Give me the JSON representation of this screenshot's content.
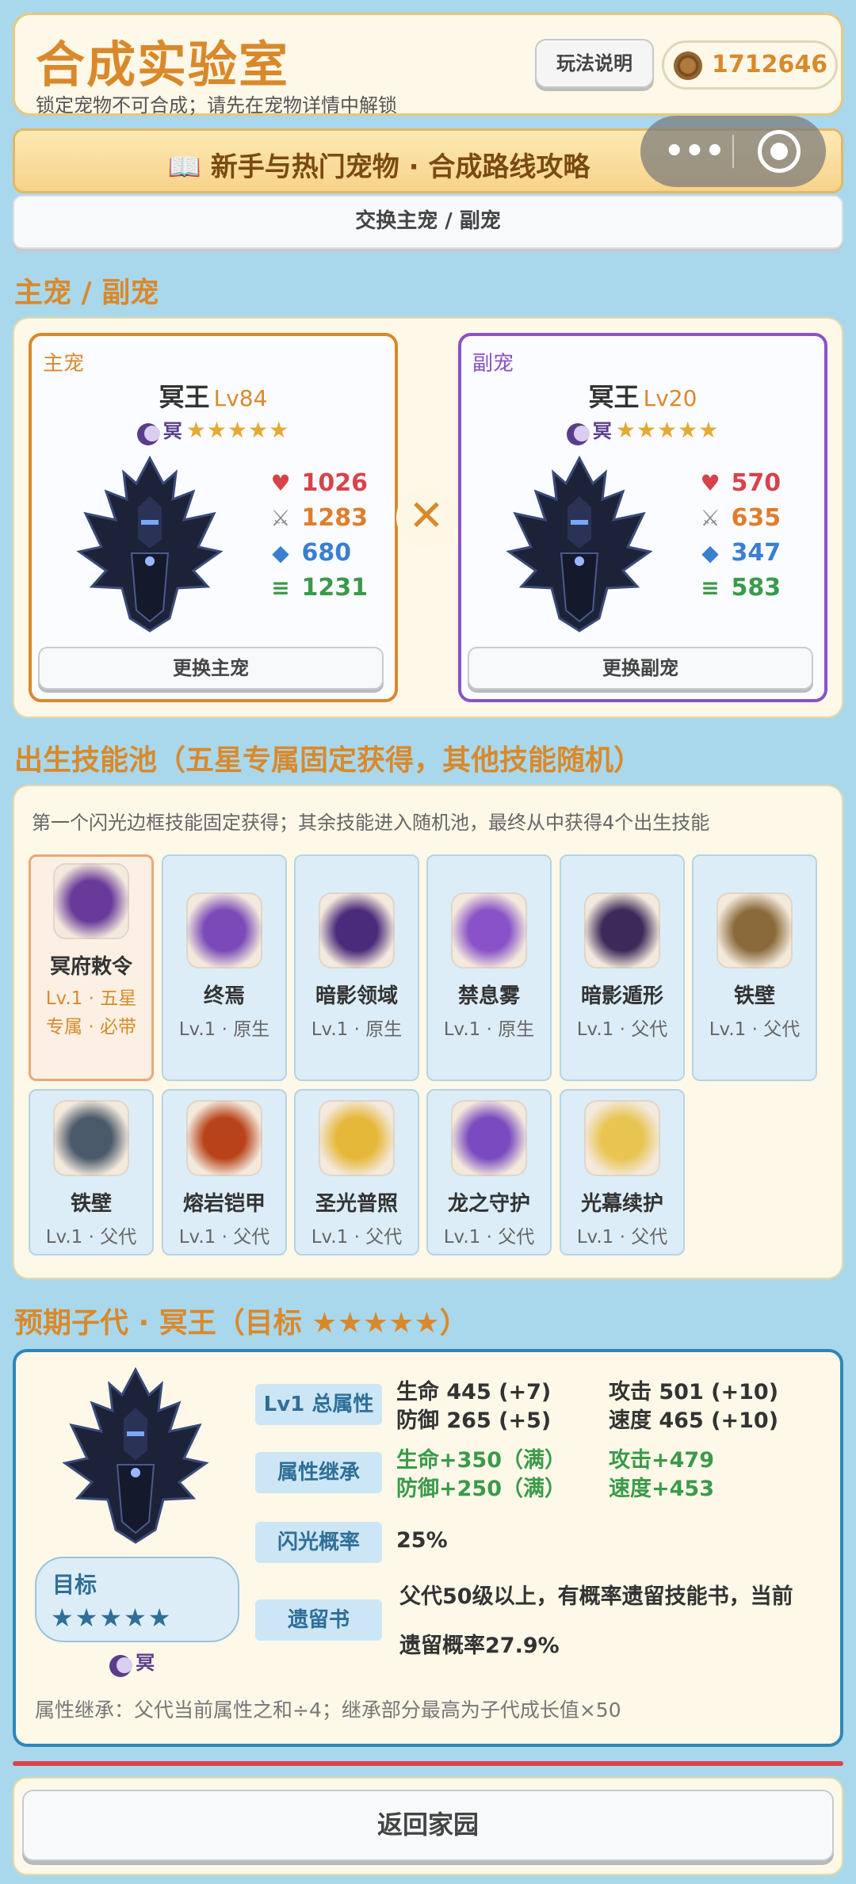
{
  "header": {
    "title": "合成实验室",
    "subtitle": "锁定宠物不可合成；请先在宠物详情中解锁",
    "help_label": "玩法说明",
    "coins": "1712646"
  },
  "guide": {
    "text": "📖 新手与热门宠物 · 合成路线攻略"
  },
  "swap": {
    "label": "交换主宠 / 副宠"
  },
  "pets_section": {
    "title": "主宠 / 副宠"
  },
  "main_pet": {
    "role": "主宠",
    "name": "冥王",
    "level": "Lv84",
    "element": "冥",
    "stars": "★★★★★",
    "hp": "1026",
    "atk": "1283",
    "def": "680",
    "spd": "1231",
    "button": "更换主宠"
  },
  "sub_pet": {
    "role": "副宠",
    "name": "冥王",
    "level": "Lv20",
    "element": "冥",
    "stars": "★★★★★",
    "hp": "570",
    "atk": "635",
    "def": "347",
    "spd": "583",
    "button": "更换副宠"
  },
  "times_symbol": "✕",
  "skills_section": {
    "title": "出生技能池（五星专属固定获得，其他技能随机）",
    "note": "第一个闪光边框技能固定获得；其余技能进入随机池，最终从中获得4个出生技能",
    "skills": [
      {
        "name": "冥府敕令",
        "meta": "Lv.1 · 五星专属 · 必带",
        "icon": "dark-crest-icon",
        "color": "#6a3a9a"
      },
      {
        "name": "终焉",
        "meta": "Lv.1 · 原生",
        "icon": "void-orb-icon",
        "color": "#7b4ab8"
      },
      {
        "name": "暗影领域",
        "meta": "Lv.1 · 原生",
        "icon": "shadow-spikes-icon",
        "color": "#4a2a7a"
      },
      {
        "name": "禁息雾",
        "meta": "Lv.1 · 原生",
        "icon": "purple-mist-icon",
        "color": "#8a52c8"
      },
      {
        "name": "暗影遁形",
        "meta": "Lv.1 · 父代",
        "icon": "shadow-cloak-icon",
        "color": "#3d2a5a"
      },
      {
        "name": "铁壁",
        "meta": "Lv.1 · 父代",
        "icon": "iron-wall-icon",
        "color": "#8a6a3a"
      },
      {
        "name": "铁壁",
        "meta": "Lv.1 · 父代",
        "icon": "steel-shield-icon",
        "color": "#4a5a6a"
      },
      {
        "name": "熔岩铠甲",
        "meta": "Lv.1 · 父代",
        "icon": "lava-armor-icon",
        "color": "#b8431a"
      },
      {
        "name": "圣光普照",
        "meta": "Lv.1 · 父代",
        "icon": "holy-light-icon",
        "color": "#e6b83a"
      },
      {
        "name": "龙之守护",
        "meta": "Lv.1 · 父代",
        "icon": "dragon-guard-icon",
        "color": "#7a4ac0"
      },
      {
        "name": "光幕续护",
        "meta": "Lv.1 · 父代",
        "icon": "light-veil-icon",
        "color": "#e8c450"
      }
    ]
  },
  "child_section": {
    "title": "预期子代 · 冥王（目标 ★★★★★）",
    "target_label": "目标",
    "target_stars": "★★★★★",
    "element": "冥",
    "rows": {
      "total_tag": "Lv1 总属性",
      "hp": "生命 445 (+7)",
      "atk": "攻击 501 (+10)",
      "def": "防御 265 (+5)",
      "spd": "速度 465 (+10)",
      "inherit_tag": "属性继承",
      "inh_hp": "生命+350（满）",
      "inh_atk": "攻击+479",
      "inh_def": "防御+250（满）",
      "inh_spd": "速度+453",
      "shiny_tag": "闪光概率",
      "shiny_val": "25%",
      "book_tag": "遗留书",
      "book_line1": "父代50级以上，有概率遗留技能书，当前",
      "book_line2": "遗留概率27.9%"
    },
    "footnote": "属性继承：父代当前属性之和÷4；继承部分最高为子代成长值×50"
  },
  "return_button": "返回家园"
}
